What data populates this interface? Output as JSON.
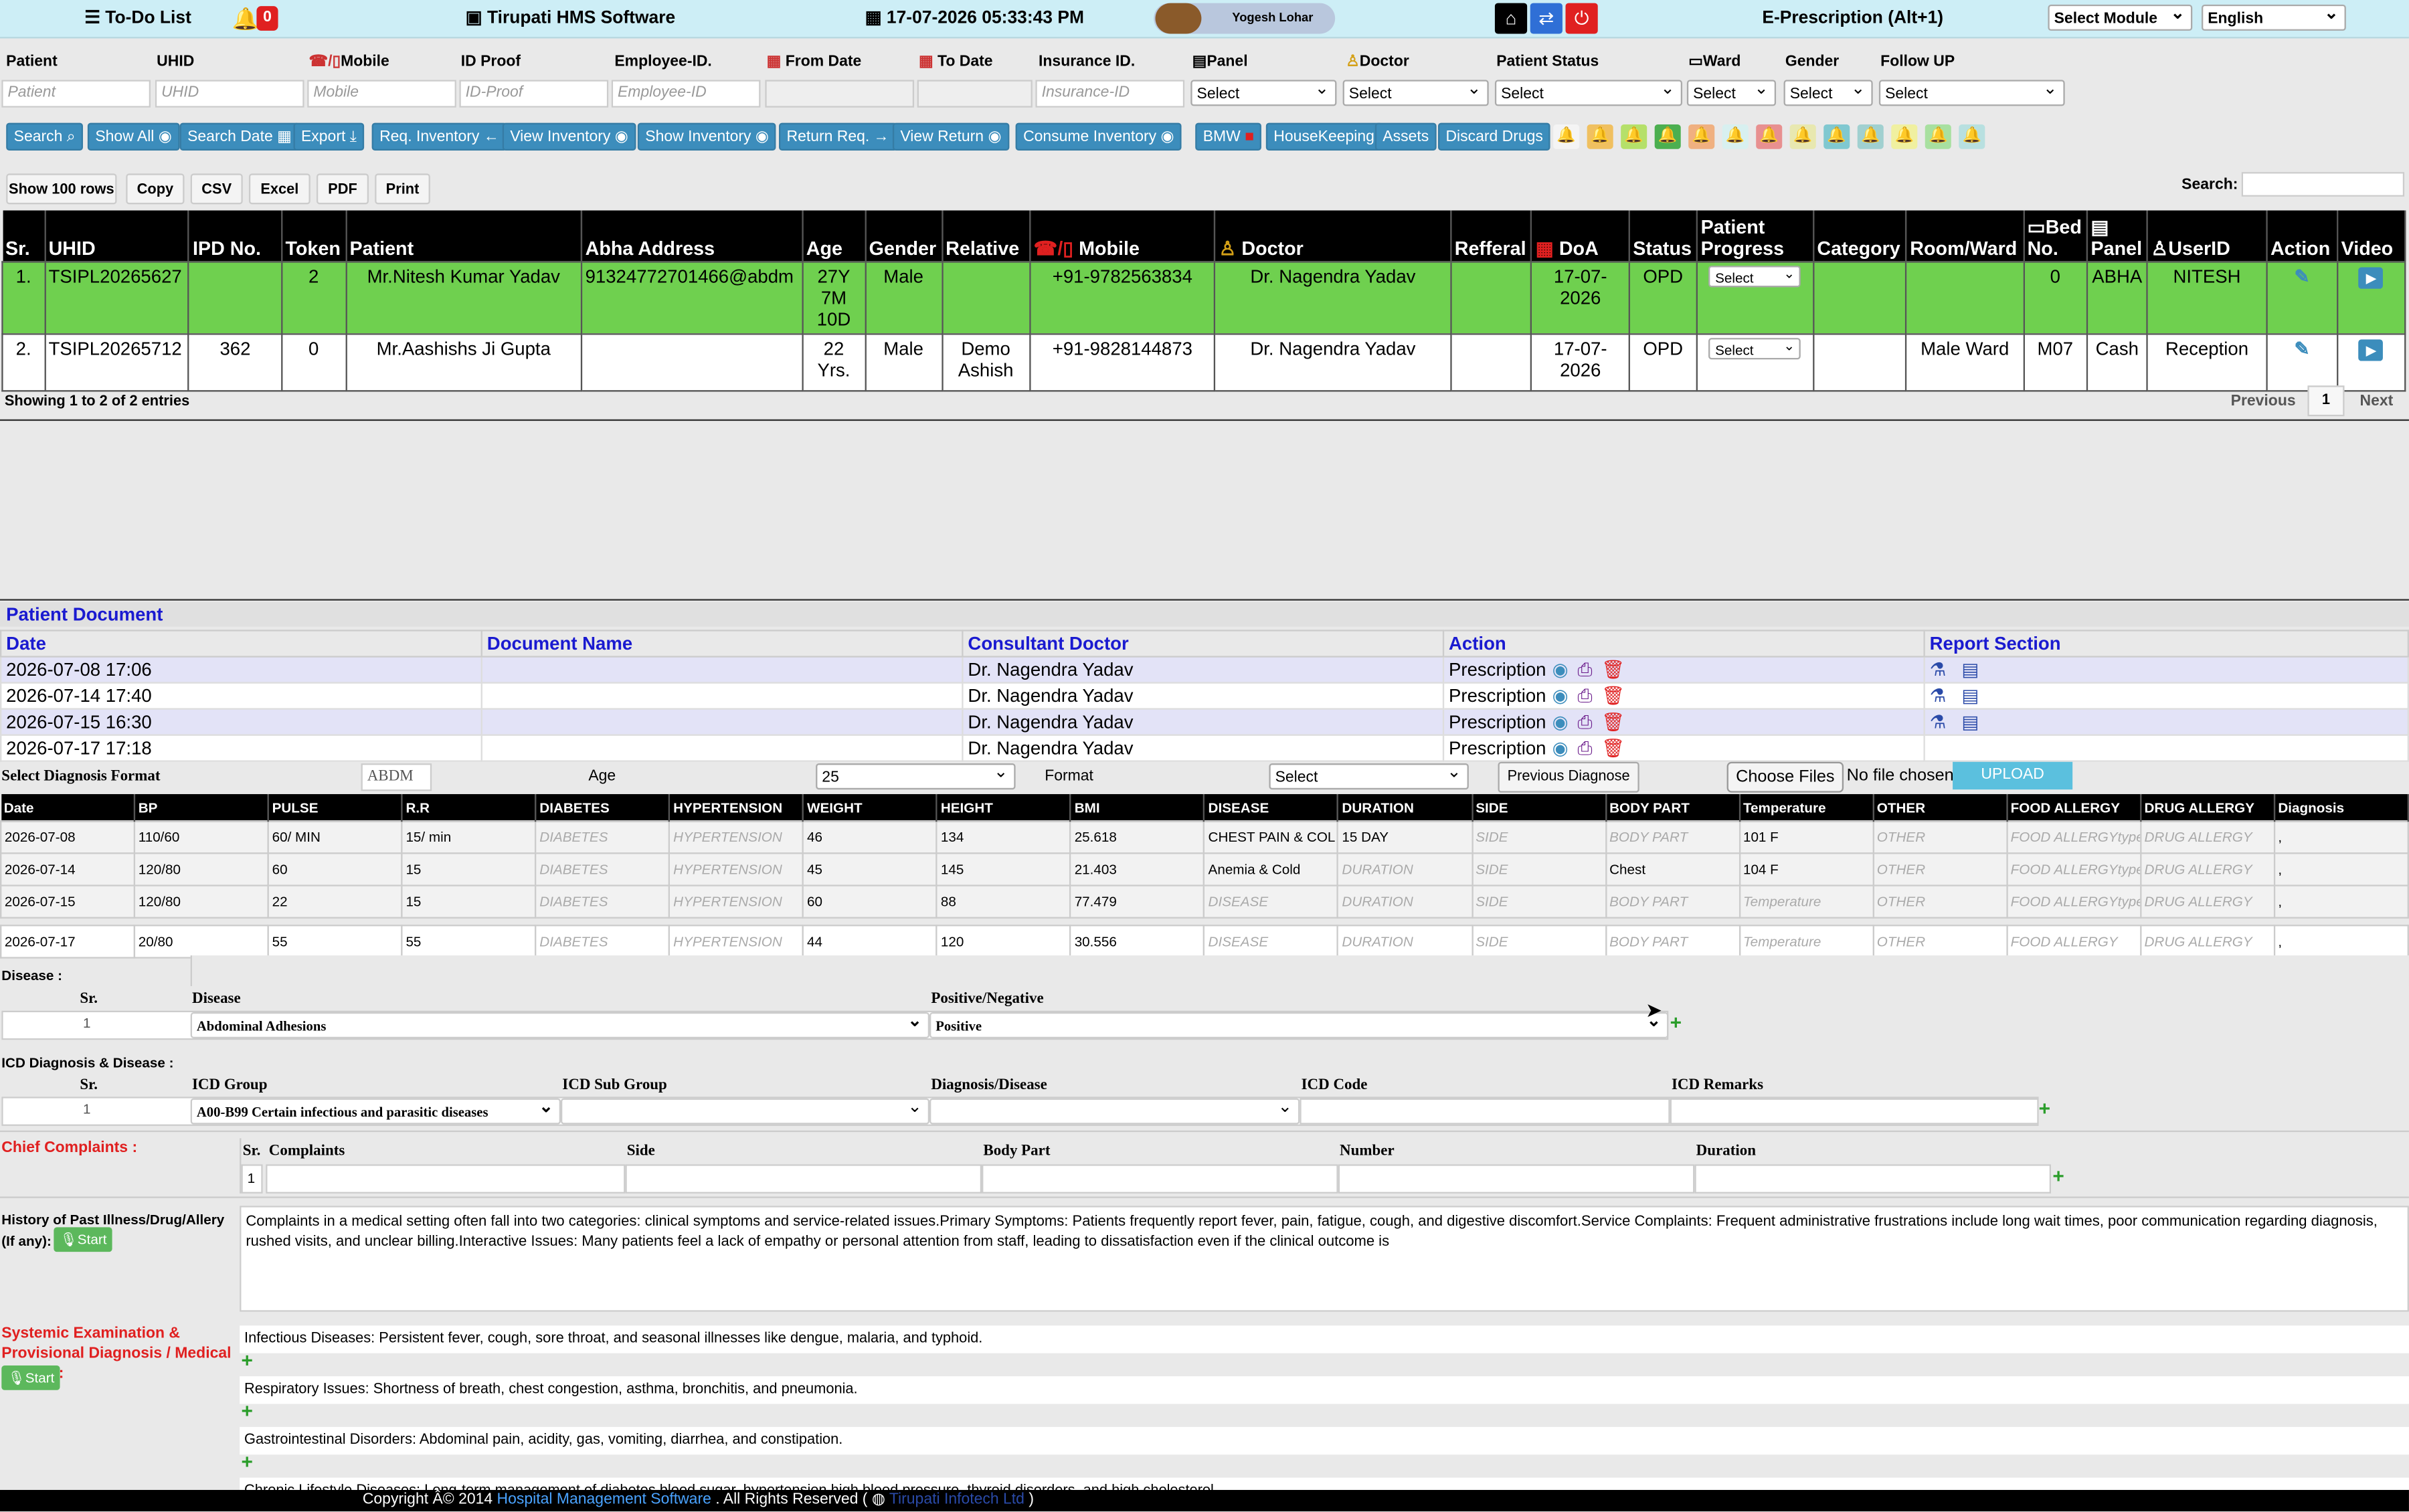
{
  "topbar": {
    "todo": "To-Do List",
    "notif_count": "0",
    "hms": "Tirupati HMS Software",
    "datetime": "17-07-2026 05:33:43 PM",
    "user": "Yogesh Lohar",
    "eprescription": "E-Prescription (Alt+1)",
    "module_select": "Select Module",
    "language": "English"
  },
  "filters": {
    "labels": {
      "patient": "Patient",
      "uhid": "UHID",
      "mobile": "Mobile",
      "id_proof": "ID Proof",
      "employee": "Employee-ID.",
      "from_date": "From Date",
      "to_date": "To Date",
      "insurance": "Insurance ID.",
      "panel": "Panel",
      "doctor": "Doctor",
      "patient_status": "Patient Status",
      "ward": "Ward",
      "gender": "Gender",
      "follow_up": "Follow UP"
    },
    "placeholders": {
      "patient": "Patient",
      "uhid": "UHID",
      "mobile": "Mobile",
      "id_proof": "ID-Proof",
      "employee": "Employee-ID",
      "insurance": "Insurance-ID"
    },
    "select": "Select"
  },
  "buttons": {
    "search": "Search",
    "show_all": "Show All",
    "search_date": "Search Date",
    "export": "Export",
    "req_inventory": "Req. Inventory",
    "view_inventory": "View Inventory",
    "show_inventory": "Show Inventory",
    "return_req": "Return Req.",
    "view_return": "View Return",
    "consume_inventory": "Consume Inventory",
    "bmw": "BMW",
    "housekeeping": "HouseKeeping",
    "assets": "Assets",
    "discard_drugs": "Discard Drugs"
  },
  "bell_colors": [
    "#f4f4f4",
    "#f0c060",
    "#b5e06a",
    "#4caf50",
    "#f0b080",
    "#d8f0f0",
    "#e89090",
    "#e8e8b0",
    "#80c8d0",
    "#a0d0d0",
    "#f0f0a0",
    "#a8e0a0",
    "#b8e0e0"
  ],
  "grid_buttons": {
    "show_rows": "Show 100 rows",
    "copy": "Copy",
    "csv": "CSV",
    "excel": "Excel",
    "pdf": "PDF",
    "print": "Print",
    "search_label": "Search:"
  },
  "table": {
    "headers": [
      "Sr.",
      "UHID",
      "IPD No.",
      "Token",
      "Patient",
      "Abha Address",
      "Age",
      "Gender",
      "Relative",
      "Mobile",
      "Doctor",
      "Refferal",
      "DoA",
      "Status",
      "Patient Progress",
      "Category",
      "Room/Ward",
      "Bed No.",
      "Panel",
      "UserID",
      "Action",
      "Video"
    ],
    "rows": [
      {
        "sr": "1.",
        "uhid": "TSIPL20265627",
        "ipd": "",
        "token": "2",
        "patient": "Mr.Nitesh Kumar Yadav",
        "abha": "91324772701466@abdm",
        "age": "27Y 7M 10D",
        "gender": "Male",
        "relative": "",
        "mobile": "+91-9782563834",
        "doctor": "Dr. Nagendra Yadav",
        "refferal": "",
        "doa": "17-07-2026",
        "status": "OPD",
        "progress": "Select",
        "category": "",
        "room": "",
        "bed": "0",
        "panel": "ABHA",
        "userid": "NITESH"
      },
      {
        "sr": "2.",
        "uhid": "TSIPL20265712",
        "ipd": "362",
        "token": "0",
        "patient": "Mr.Aashishs Ji Gupta",
        "abha": "",
        "age": "22 Yrs.",
        "gender": "Male",
        "relative": "Demo Ashish",
        "mobile": "+91-9828144873",
        "doctor": "Dr. Nagendra Yadav",
        "refferal": "",
        "doa": "17-07-2026",
        "status": "OPD",
        "progress": "Select",
        "category": "",
        "room": "Male Ward",
        "bed": "M07",
        "panel": "Cash",
        "userid": "Reception"
      }
    ],
    "showing": "Showing 1 to 2 of 2 entries",
    "prev": "Previous",
    "page": "1",
    "next": "Next"
  },
  "documents": {
    "title": "Patient Document",
    "headers": [
      "Date",
      "Document Name",
      "Consultant Doctor",
      "Action",
      "Report Section"
    ],
    "rows": [
      {
        "date": "2026-07-08 17:06",
        "name": "",
        "doctor": "Dr. Nagendra Yadav",
        "action": "Prescription"
      },
      {
        "date": "2026-07-14 17:40",
        "name": "",
        "doctor": "Dr. Nagendra Yadav",
        "action": "Prescription"
      },
      {
        "date": "2026-07-15 16:30",
        "name": "",
        "doctor": "Dr. Nagendra Yadav",
        "action": "Prescription"
      },
      {
        "date": "2026-07-17 17:18",
        "name": "",
        "doctor": "Dr. Nagendra Yadav",
        "action": "Prescription"
      }
    ]
  },
  "diag_format": {
    "label": "Select Diagnosis Format",
    "abdm": "ABDM Re",
    "age_label": "Age",
    "age_value": "25",
    "format_label": "Format",
    "format_value": "Select",
    "prev_btn": "Previous Diagnose",
    "choose": "Choose Files",
    "nofile": "No file chosen",
    "upload": "UPLOAD"
  },
  "vitals": {
    "headers": [
      "Date",
      "BP",
      "PULSE",
      "R.R",
      "DIABETES",
      "HYPERTENSION",
      "WEIGHT",
      "HEIGHT",
      "BMI",
      "DISEASE",
      "DURATION",
      "SIDE",
      "BODY PART",
      "Temperature",
      "OTHER",
      "FOOD ALLERGY",
      "DRUG ALLERGY",
      "Diagnosis"
    ],
    "rows": [
      [
        "2026-07-08",
        "110/60",
        "60/ MIN",
        "15/ min",
        "DIABETES",
        "HYPERTENSION",
        "46",
        "134",
        "25.618",
        "CHEST PAIN & COL",
        "15 DAY",
        "SIDE",
        "BODY PART",
        "101  F",
        "OTHER",
        "FOOD ALLERGYtype",
        "DRUG ALLERGY",
        ","
      ],
      [
        "2026-07-14",
        "120/80",
        "60",
        "15",
        "DIABETES",
        "HYPERTENSION",
        "45",
        "145",
        "21.403",
        "Anemia & Cold",
        "DURATION",
        "SIDE",
        "Chest",
        "104 F",
        "OTHER",
        "FOOD ALLERGYtype",
        "DRUG ALLERGY",
        ","
      ],
      [
        "2026-07-15",
        "120/80",
        "22",
        "15",
        "DIABETES",
        "HYPERTENSION",
        "60",
        "88",
        "77.479",
        "DISEASE",
        "DURATION",
        "SIDE",
        "BODY PART",
        "Temperature",
        "OTHER",
        "FOOD ALLERGYtype",
        "DRUG ALLERGY",
        ","
      ],
      [
        "2026-07-17",
        "20/80",
        "55",
        "55",
        "DIABETES",
        "HYPERTENSION",
        "44",
        "120",
        "30.556",
        "DISEASE",
        "DURATION",
        "SIDE",
        "BODY PART",
        "Temperature",
        "OTHER",
        "FOOD ALLERGY",
        "DRUG ALLERGY",
        ","
      ]
    ]
  },
  "disease": {
    "title": "Disease :",
    "sr": "Sr.",
    "disease_h": "Disease",
    "pn_h": "Positive/Negative",
    "row_sr": "1",
    "disease": "Abdominal Adhesions",
    "pn": "Positive"
  },
  "icd": {
    "title": "ICD Diagnosis & Disease :",
    "sr": "Sr.",
    "group_h": "ICD Group",
    "sub_h": "ICD Sub Group",
    "diag_h": "Diagnosis/Disease",
    "code_h": "ICD Code",
    "remarks_h": "ICD Remarks",
    "row_sr": "1",
    "group": "A00-B99 Certain infectious and parasitic diseases"
  },
  "chief": {
    "title": "Chief Complaints :",
    "sr": "Sr.",
    "complaints": "Complaints",
    "side": "Side",
    "body": "Body Part",
    "number": "Number",
    "duration": "Duration",
    "row_sr": "1"
  },
  "history": {
    "title": "History of Past Illness/Drug/Allery (If any):",
    "start": "Start",
    "text": "Complaints in a medical setting often fall into two categories: clinical symptoms and service-related issues.Primary Symptoms: Patients frequently report fever, pain, fatigue, cough, and digestive discomfort.Service Complaints: Frequent administrative frustrations include long wait times, poor communication regarding diagnosis, rushed visits, and unclear billing.Interactive Issues: Many patients feel a lack of empathy or personal attention from staff, leading to dissatisfaction even if the clinical outcome is"
  },
  "systemic": {
    "title": "Systemic Examination & Provisional Diagnosis / Medical History :",
    "start": "Start",
    "items": [
      "Infectious Diseases: Persistent fever, cough, sore throat, and seasonal illnesses like dengue, malaria, and typhoid.",
      "Respiratory Issues: Shortness of breath, chest congestion, asthma, bronchitis, and pneumonia.",
      "Gastrointestinal Disorders: Abdominal pain, acidity, gas, vomiting, diarrhea, and constipation.",
      "Chronic Lifestyle Diseases: Long-term management of diabetes blood sugar, hypertension high blood pressure, thyroid disorders, and high cholesterol."
    ]
  },
  "footer": {
    "copyright": "Copyright Â© 2014",
    "link": "Hospital Management Software",
    "rights": ". All Rights Reserved (",
    "company": "Tirupati Infotech Ltd",
    ")": ")"
  }
}
